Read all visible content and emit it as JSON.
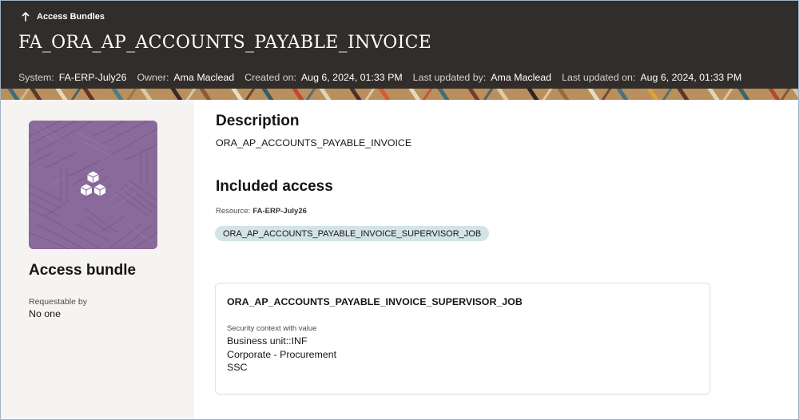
{
  "header": {
    "back_label": "Access Bundles",
    "title": "FA_ORA_AP_ACCOUNTS_PAYABLE_INVOICE",
    "meta": [
      {
        "label": "System:",
        "value": "FA-ERP-July26"
      },
      {
        "label": "Owner:",
        "value": "Ama Maclead"
      },
      {
        "label": "Created on:",
        "value": "Aug 6, 2024, 01:33 PM"
      },
      {
        "label": "Last updated by:",
        "value": "Ama Maclead"
      },
      {
        "label": "Last updated on:",
        "value": "Aug 6, 2024, 01:33 PM"
      }
    ]
  },
  "sidebar": {
    "icon": "access-bundle-icon",
    "tile_color": "#8a6a9a",
    "title": "Access bundle",
    "requestable_label": "Requestable by",
    "requestable_value": "No one"
  },
  "main": {
    "description_heading": "Description",
    "description": "ORA_AP_ACCOUNTS_PAYABLE_INVOICE",
    "included_heading": "Included access",
    "resource_label": "Resource:",
    "resource_value": "FA-ERP-July26",
    "chip": "ORA_AP_ACCOUNTS_PAYABLE_INVOICE_SUPERVISOR_JOB",
    "card": {
      "title": "ORA_AP_ACCOUNTS_PAYABLE_INVOICE_SUPERVISOR_JOB",
      "context_label": "Security context with value",
      "context_values": [
        "Business unit::INF",
        "Corporate - Procurement",
        "SSC"
      ]
    }
  },
  "colors": {
    "header_bg": "#312d2a",
    "chip_bg": "#d3e3e7",
    "sidebar_bg": "#f5f4f2"
  }
}
